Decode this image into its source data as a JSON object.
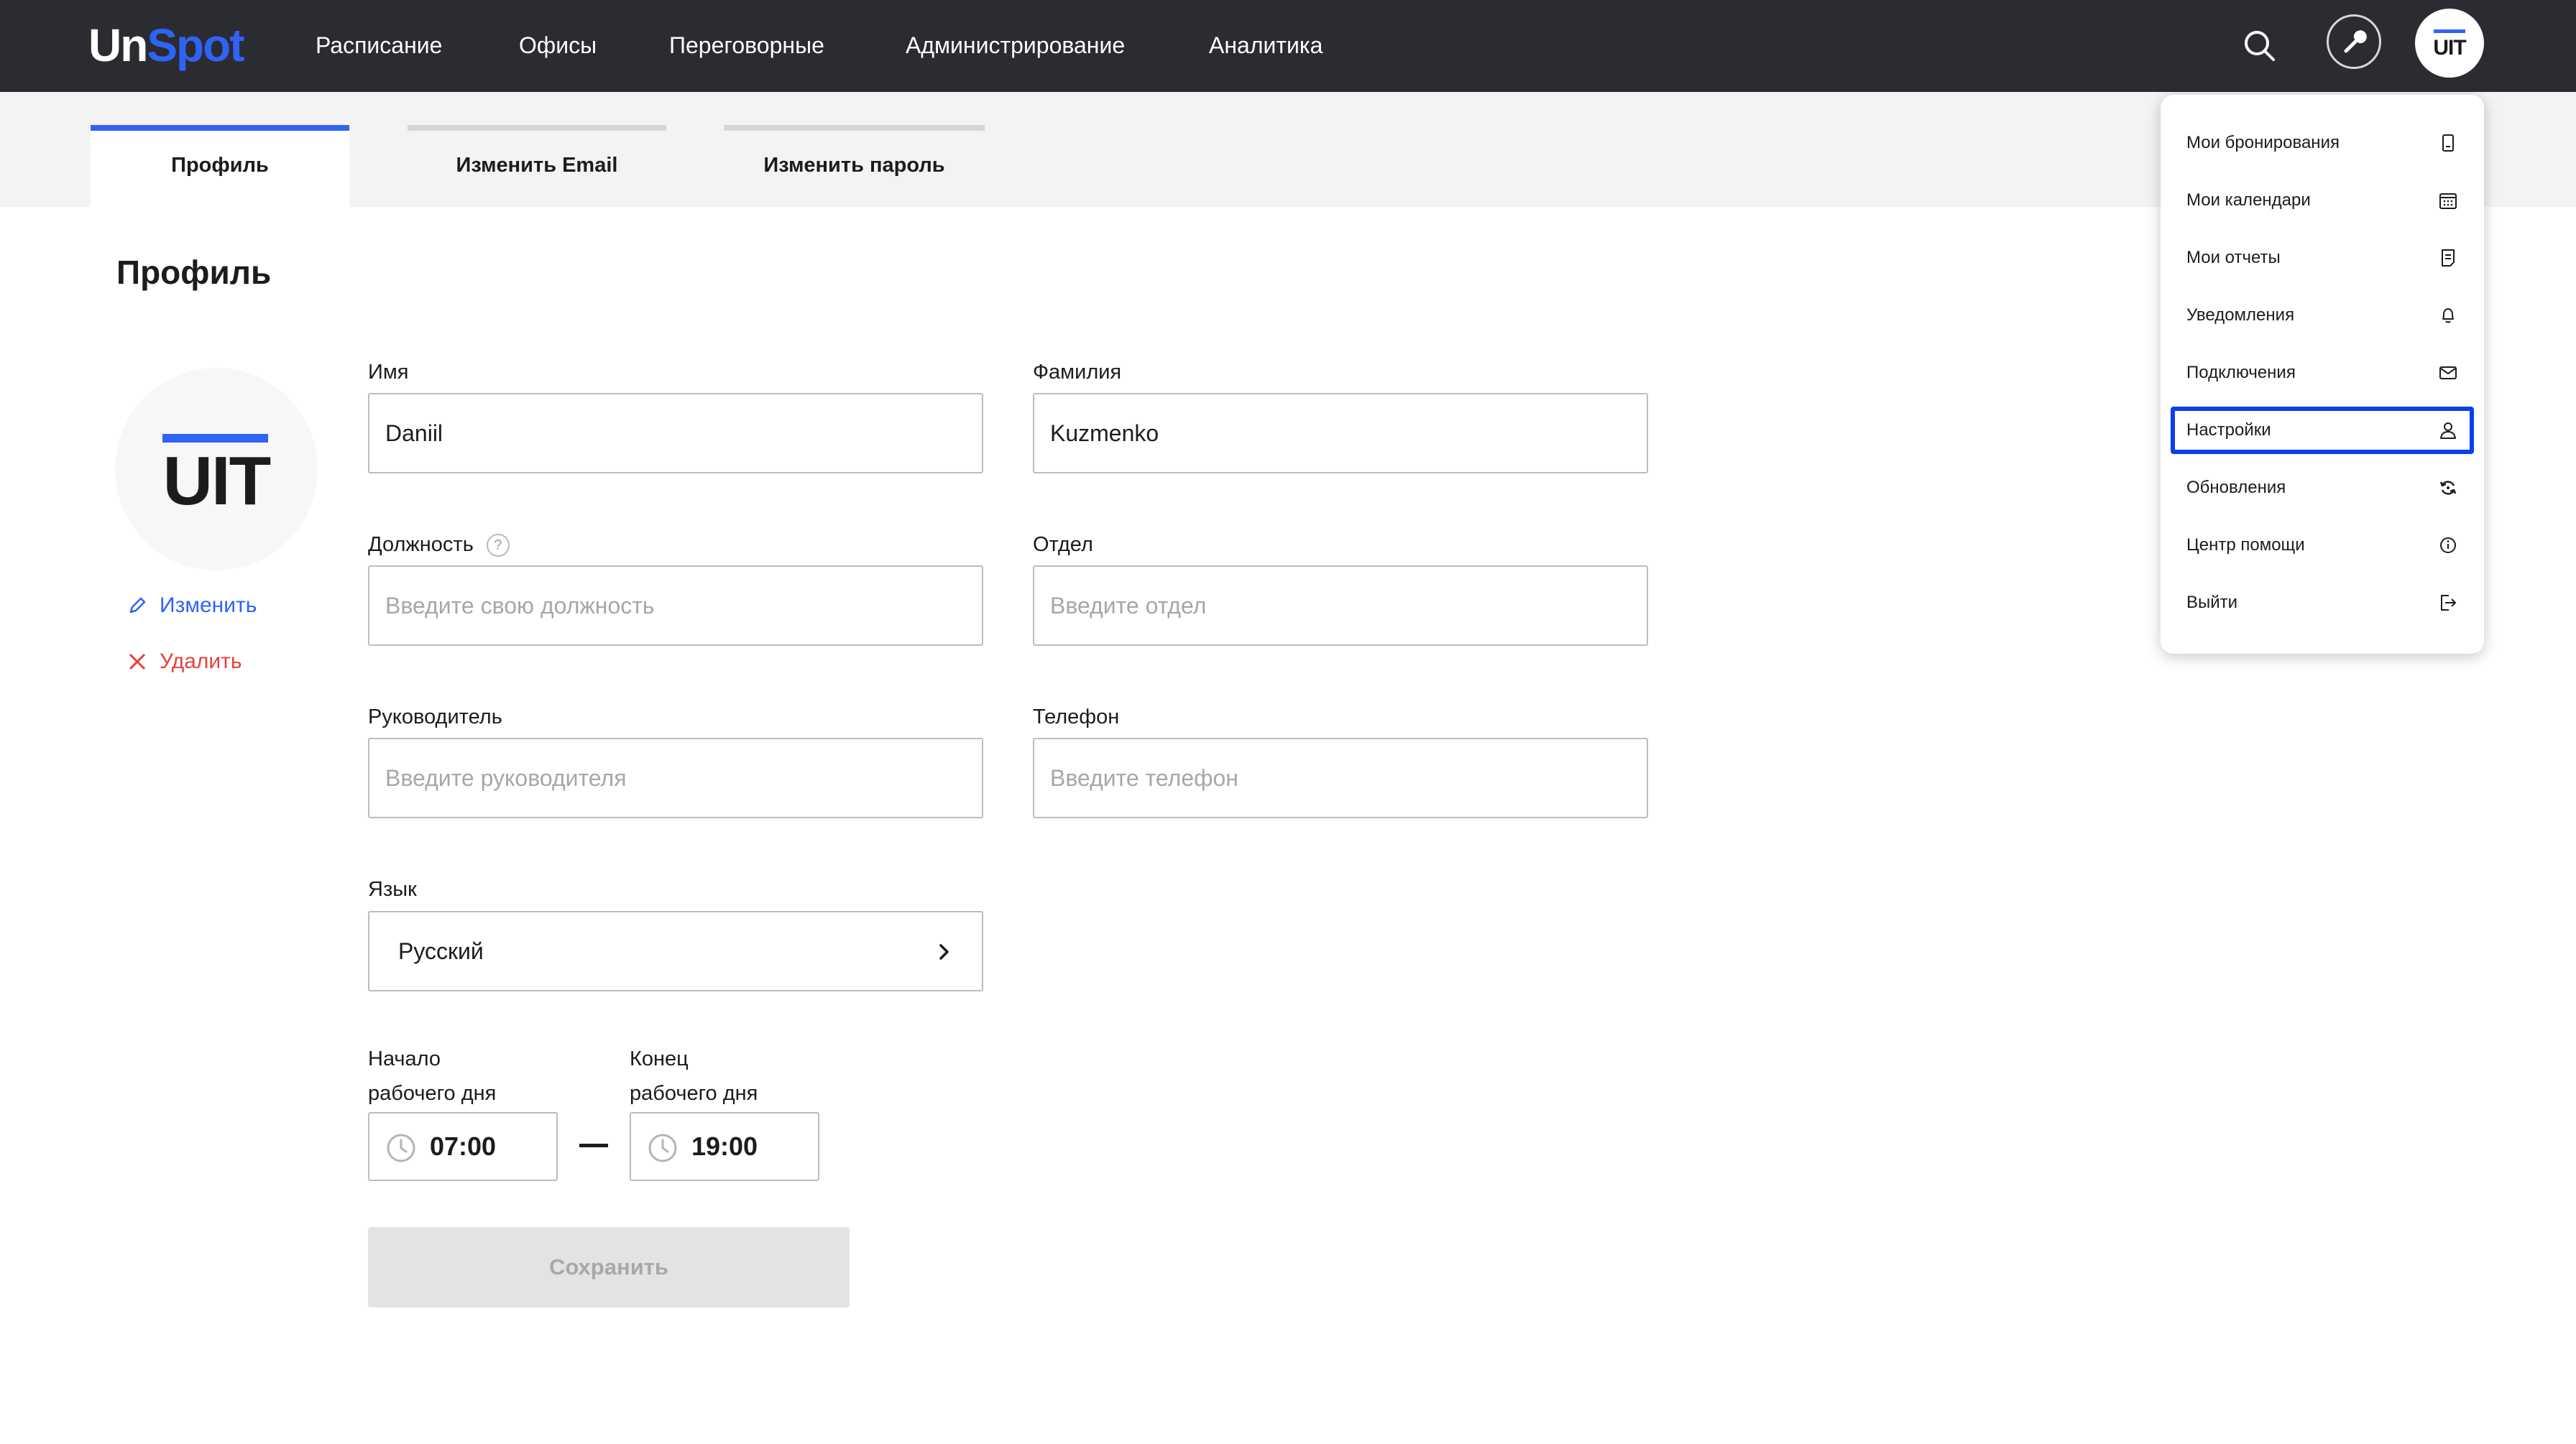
{
  "logo": {
    "part1": "Un",
    "part2": "Spot"
  },
  "nav": {
    "items": [
      {
        "label": "Расписание"
      },
      {
        "label": "Офисы"
      },
      {
        "label": "Переговорные"
      },
      {
        "label": "Администрирование"
      },
      {
        "label": "Аналитика"
      }
    ],
    "icons": {
      "search": "search-icon",
      "tools": "wrench-icon"
    },
    "avatar_text": "UIT"
  },
  "tabs": [
    {
      "label": "Профиль",
      "active": true
    },
    {
      "label": "Изменить Email",
      "active": false
    },
    {
      "label": "Изменить пароль",
      "active": false
    }
  ],
  "profile": {
    "title": "Профиль",
    "avatar_text": "UIT",
    "edit_label": "Изменить",
    "delete_label": "Удалить"
  },
  "form": {
    "first_name": {
      "label": "Имя",
      "value": "Daniil"
    },
    "last_name": {
      "label": "Фамилия",
      "value": "Kuzmenko"
    },
    "position": {
      "label": "Должность",
      "help": "?",
      "placeholder": "Введите свою должность",
      "value": ""
    },
    "department": {
      "label": "Отдел",
      "placeholder": "Введите отдел",
      "value": ""
    },
    "manager": {
      "label": "Руководитель",
      "placeholder": "Введите руководителя",
      "value": ""
    },
    "phone": {
      "label": "Телефон",
      "placeholder": "Введите телефон",
      "value": ""
    },
    "language": {
      "label": "Язык",
      "value": "Русский"
    },
    "work_start": {
      "label_line1": "Начало",
      "label_line2": "рабочего дня",
      "value": "07:00"
    },
    "work_end": {
      "label_line1": "Конец",
      "label_line2": "рабочего дня",
      "value": "19:00"
    },
    "save_label": "Сохранить"
  },
  "menu": {
    "items": [
      {
        "label": "Мои бронирования",
        "icon": "booking-icon"
      },
      {
        "label": "Мои календари",
        "icon": "calendar-icon"
      },
      {
        "label": "Мои отчеты",
        "icon": "report-icon"
      },
      {
        "label": "Уведомления",
        "icon": "bell-icon"
      },
      {
        "label": "Подключения",
        "icon": "mail-icon"
      },
      {
        "label": "Настройки",
        "icon": "user-icon",
        "selected": true
      },
      {
        "label": "Обновления",
        "icon": "refresh-icon"
      },
      {
        "label": "Центр помощи",
        "icon": "info-icon"
      },
      {
        "label": "Выйти",
        "icon": "logout-icon"
      }
    ]
  },
  "colors": {
    "topbar": "#2b2c31",
    "accent": "#2f63f5",
    "danger": "#e5413f",
    "selection_outline": "#0a3ff0",
    "disabled_button": "#e3e3e3"
  }
}
